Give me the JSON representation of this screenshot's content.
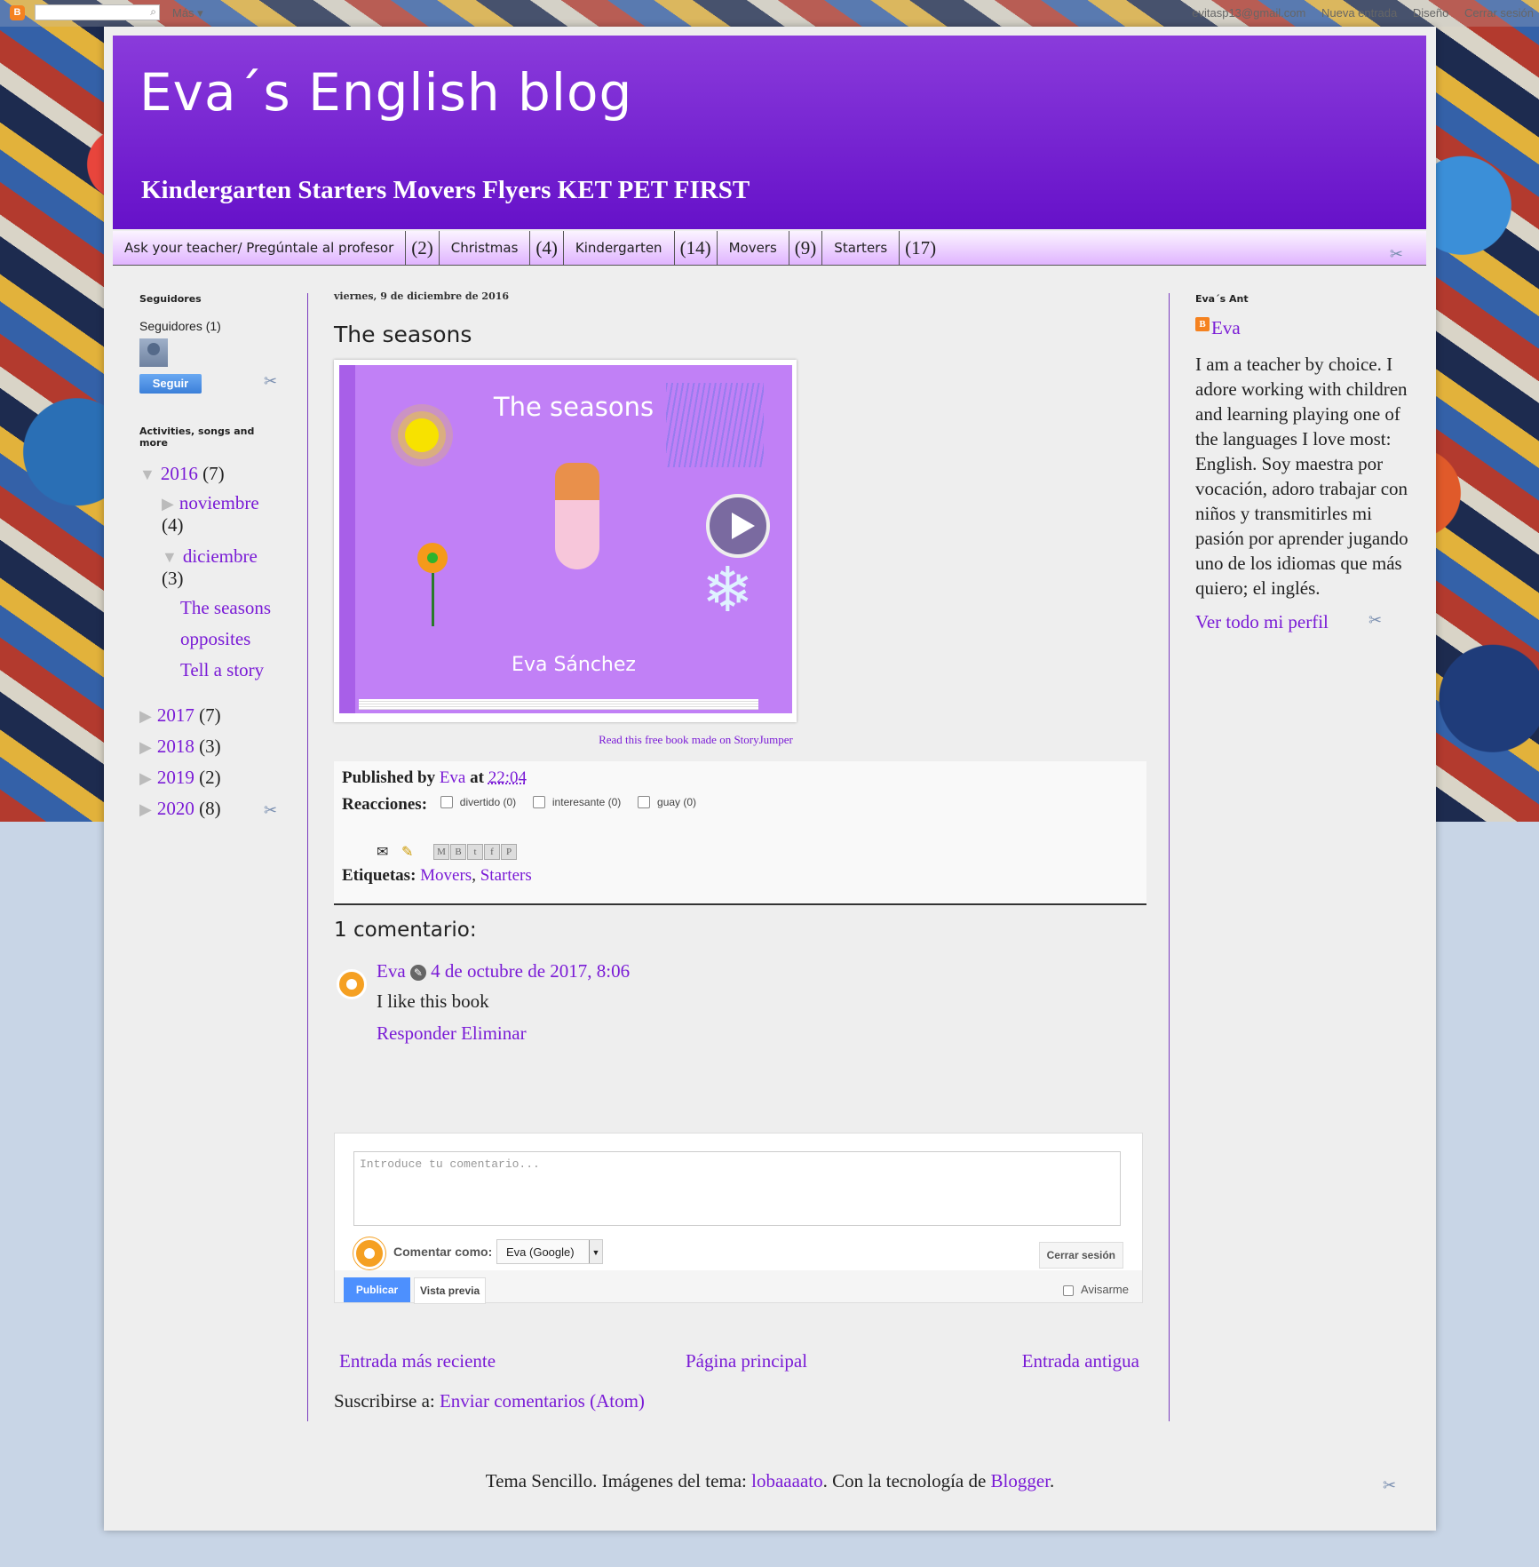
{
  "topbar": {
    "more": "Más ▾",
    "email": "evitasp13@gmail.com",
    "new_post": "Nueva entrada",
    "design": "Diseño",
    "logout": "Cerrar sesión"
  },
  "header": {
    "title": "Eva´s English blog",
    "description": "Kindergarten Starters Movers Flyers KET PET FIRST"
  },
  "tabs": [
    {
      "label": "Ask your teacher/ Pregúntale al profesor"
    },
    {
      "label": "(2)"
    },
    {
      "label": "Christmas"
    },
    {
      "label": "(4)"
    },
    {
      "label": "Kindergarten"
    },
    {
      "label": "(14)"
    },
    {
      "label": "Movers"
    },
    {
      "label": "(9)"
    },
    {
      "label": "Starters"
    },
    {
      "label": "(17)"
    }
  ],
  "sidebar_left": {
    "followers_title": "Seguidores",
    "followers_count": "Seguidores (1)",
    "follow_button": "Seguir",
    "archive_title": "Activities, songs and more",
    "archive": [
      {
        "year": "2016",
        "count": "(7)"
      },
      {
        "month": "noviembre",
        "count": "(4)"
      },
      {
        "month": "diciembre",
        "count": "(3)"
      },
      {
        "post": "The seasons"
      },
      {
        "post": "opposites"
      },
      {
        "post": "Tell a story"
      },
      {
        "year": "2017",
        "count": "(7)"
      },
      {
        "year": "2018",
        "count": "(3)"
      },
      {
        "year": "2019",
        "count": "(2)"
      },
      {
        "year": "2020",
        "count": "(8)"
      }
    ]
  },
  "post": {
    "date": "viernes, 9 de diciembre de 2016",
    "title": "The seasons",
    "book_title": "The seasons",
    "book_author": "Eva Sánchez",
    "read_free": "Read this free book made on StoryJumper",
    "published_by_label": "Published by",
    "author": "Eva",
    "at_label": "at",
    "time": "22:04",
    "reactions_label": "Reacciones:",
    "reactions": [
      "divertido (0)",
      "interesante (0)",
      "guay (0)"
    ],
    "labels_label": "Etiquetas:",
    "labels": [
      "Movers",
      "Starters"
    ]
  },
  "comments": {
    "heading": "1 comentario:",
    "items": [
      {
        "author": "Eva",
        "date": "4 de octubre de 2017, 8:06",
        "text": "I like this book",
        "reply": "Responder",
        "delete": "Eliminar"
      }
    ],
    "form": {
      "placeholder": "Introduce tu comentario...",
      "comment_as": "Comentar como:",
      "identity": "Eva (Google)",
      "logout": "Cerrar sesión",
      "publish": "Publicar",
      "preview": "Vista previa",
      "notify": "Avisarme"
    }
  },
  "pager": {
    "newer": "Entrada más reciente",
    "home": "Página principal",
    "older": "Entrada antigua"
  },
  "subscribe": {
    "label": "Suscribirse a:",
    "link": "Enviar comentarios (Atom)"
  },
  "sidebar_right": {
    "title": "Eva´s Ant",
    "name": "Eva",
    "about": "I am a teacher by choice. I adore working with children and learning playing one of the languages I love most: English. Soy maestra por vocación, adoro trabajar con niños y transmitirles mi pasión por aprender jugando uno de los idiomas que más quiero; el inglés.",
    "view_profile": "Ver todo mi perfil"
  },
  "attribution": {
    "prefix": "Tema Sencillo. Imágenes del tema:",
    "image_author": "lobaaaato",
    "middle": ". Con la tecnología de",
    "platform": "Blogger",
    "suffix": "."
  },
  "colors": {
    "accent": "#7a1bd6",
    "header_top": "#8a3bdb",
    "header_bottom": "#6611c9",
    "background": "#c8d5e6"
  }
}
